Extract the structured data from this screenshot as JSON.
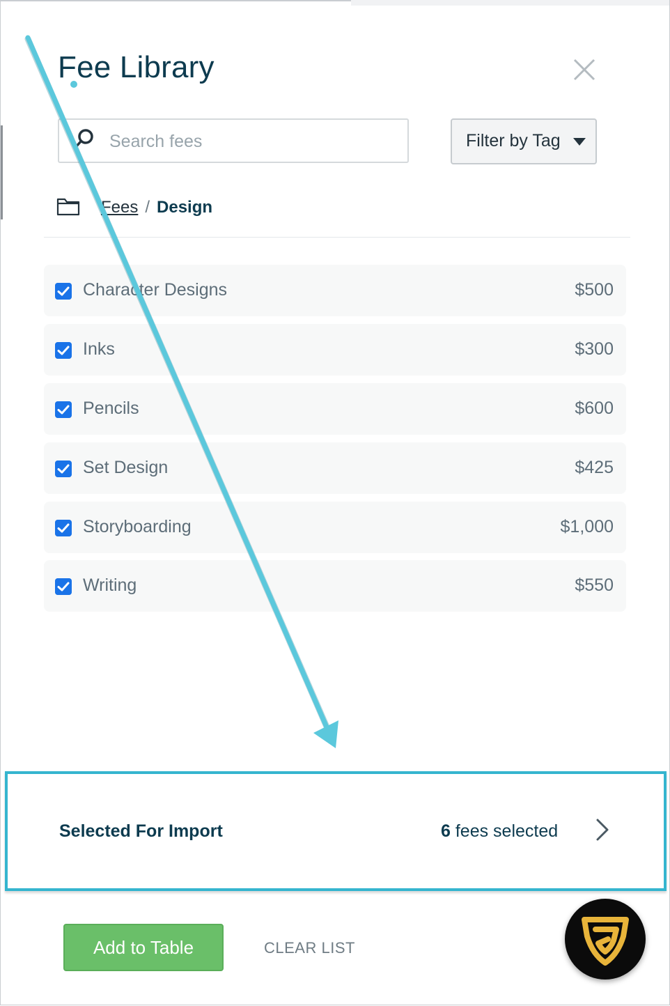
{
  "header": {
    "title": "Fee Library",
    "close_icon": "close-icon"
  },
  "search": {
    "placeholder": "Search fees",
    "value": ""
  },
  "filter": {
    "label": "Filter by Tag",
    "icon": "caret-down-icon"
  },
  "breadcrumb": {
    "parent": "Fees",
    "separator": "/",
    "current": "Design"
  },
  "fees": [
    {
      "name": "Character Designs",
      "price": "$500",
      "checked": true
    },
    {
      "name": "Inks",
      "price": "$300",
      "checked": true
    },
    {
      "name": "Pencils",
      "price": "$600",
      "checked": true
    },
    {
      "name": "Set Design",
      "price": "$425",
      "checked": true
    },
    {
      "name": "Storyboarding",
      "price": "$1,000",
      "checked": true
    },
    {
      "name": "Writing",
      "price": "$550",
      "checked": true
    }
  ],
  "import_panel": {
    "title": "Selected For Import",
    "count": "6",
    "count_suffix": "fees selected"
  },
  "actions": {
    "add_label": "Add to Table",
    "clear_label": "CLEAR LIST"
  },
  "colors": {
    "title": "#0d3b4f",
    "checkbox": "#1a73e8",
    "add_button": "#6abf69",
    "annotation": "#5bc8dc",
    "highlight_border": "#35b5cf",
    "logo_gold": "#e8b43a"
  }
}
